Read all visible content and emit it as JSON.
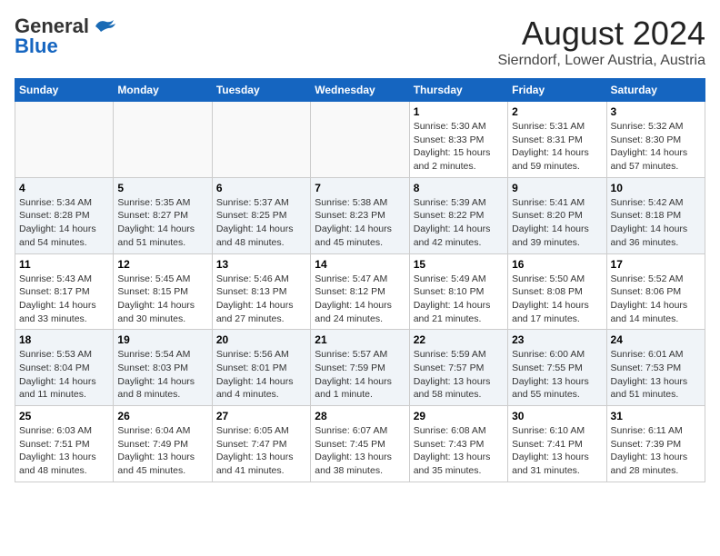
{
  "header": {
    "logo_general": "General",
    "logo_blue": "Blue",
    "month": "August 2024",
    "location": "Sierndorf, Lower Austria, Austria"
  },
  "weekdays": [
    "Sunday",
    "Monday",
    "Tuesday",
    "Wednesday",
    "Thursday",
    "Friday",
    "Saturday"
  ],
  "weeks": [
    [
      {
        "day": "",
        "info": ""
      },
      {
        "day": "",
        "info": ""
      },
      {
        "day": "",
        "info": ""
      },
      {
        "day": "",
        "info": ""
      },
      {
        "day": "1",
        "info": "Sunrise: 5:30 AM\nSunset: 8:33 PM\nDaylight: 15 hours\nand 2 minutes."
      },
      {
        "day": "2",
        "info": "Sunrise: 5:31 AM\nSunset: 8:31 PM\nDaylight: 14 hours\nand 59 minutes."
      },
      {
        "day": "3",
        "info": "Sunrise: 5:32 AM\nSunset: 8:30 PM\nDaylight: 14 hours\nand 57 minutes."
      }
    ],
    [
      {
        "day": "4",
        "info": "Sunrise: 5:34 AM\nSunset: 8:28 PM\nDaylight: 14 hours\nand 54 minutes."
      },
      {
        "day": "5",
        "info": "Sunrise: 5:35 AM\nSunset: 8:27 PM\nDaylight: 14 hours\nand 51 minutes."
      },
      {
        "day": "6",
        "info": "Sunrise: 5:37 AM\nSunset: 8:25 PM\nDaylight: 14 hours\nand 48 minutes."
      },
      {
        "day": "7",
        "info": "Sunrise: 5:38 AM\nSunset: 8:23 PM\nDaylight: 14 hours\nand 45 minutes."
      },
      {
        "day": "8",
        "info": "Sunrise: 5:39 AM\nSunset: 8:22 PM\nDaylight: 14 hours\nand 42 minutes."
      },
      {
        "day": "9",
        "info": "Sunrise: 5:41 AM\nSunset: 8:20 PM\nDaylight: 14 hours\nand 39 minutes."
      },
      {
        "day": "10",
        "info": "Sunrise: 5:42 AM\nSunset: 8:18 PM\nDaylight: 14 hours\nand 36 minutes."
      }
    ],
    [
      {
        "day": "11",
        "info": "Sunrise: 5:43 AM\nSunset: 8:17 PM\nDaylight: 14 hours\nand 33 minutes."
      },
      {
        "day": "12",
        "info": "Sunrise: 5:45 AM\nSunset: 8:15 PM\nDaylight: 14 hours\nand 30 minutes."
      },
      {
        "day": "13",
        "info": "Sunrise: 5:46 AM\nSunset: 8:13 PM\nDaylight: 14 hours\nand 27 minutes."
      },
      {
        "day": "14",
        "info": "Sunrise: 5:47 AM\nSunset: 8:12 PM\nDaylight: 14 hours\nand 24 minutes."
      },
      {
        "day": "15",
        "info": "Sunrise: 5:49 AM\nSunset: 8:10 PM\nDaylight: 14 hours\nand 21 minutes."
      },
      {
        "day": "16",
        "info": "Sunrise: 5:50 AM\nSunset: 8:08 PM\nDaylight: 14 hours\nand 17 minutes."
      },
      {
        "day": "17",
        "info": "Sunrise: 5:52 AM\nSunset: 8:06 PM\nDaylight: 14 hours\nand 14 minutes."
      }
    ],
    [
      {
        "day": "18",
        "info": "Sunrise: 5:53 AM\nSunset: 8:04 PM\nDaylight: 14 hours\nand 11 minutes."
      },
      {
        "day": "19",
        "info": "Sunrise: 5:54 AM\nSunset: 8:03 PM\nDaylight: 14 hours\nand 8 minutes."
      },
      {
        "day": "20",
        "info": "Sunrise: 5:56 AM\nSunset: 8:01 PM\nDaylight: 14 hours\nand 4 minutes."
      },
      {
        "day": "21",
        "info": "Sunrise: 5:57 AM\nSunset: 7:59 PM\nDaylight: 14 hours\nand 1 minute."
      },
      {
        "day": "22",
        "info": "Sunrise: 5:59 AM\nSunset: 7:57 PM\nDaylight: 13 hours\nand 58 minutes."
      },
      {
        "day": "23",
        "info": "Sunrise: 6:00 AM\nSunset: 7:55 PM\nDaylight: 13 hours\nand 55 minutes."
      },
      {
        "day": "24",
        "info": "Sunrise: 6:01 AM\nSunset: 7:53 PM\nDaylight: 13 hours\nand 51 minutes."
      }
    ],
    [
      {
        "day": "25",
        "info": "Sunrise: 6:03 AM\nSunset: 7:51 PM\nDaylight: 13 hours\nand 48 minutes."
      },
      {
        "day": "26",
        "info": "Sunrise: 6:04 AM\nSunset: 7:49 PM\nDaylight: 13 hours\nand 45 minutes."
      },
      {
        "day": "27",
        "info": "Sunrise: 6:05 AM\nSunset: 7:47 PM\nDaylight: 13 hours\nand 41 minutes."
      },
      {
        "day": "28",
        "info": "Sunrise: 6:07 AM\nSunset: 7:45 PM\nDaylight: 13 hours\nand 38 minutes."
      },
      {
        "day": "29",
        "info": "Sunrise: 6:08 AM\nSunset: 7:43 PM\nDaylight: 13 hours\nand 35 minutes."
      },
      {
        "day": "30",
        "info": "Sunrise: 6:10 AM\nSunset: 7:41 PM\nDaylight: 13 hours\nand 31 minutes."
      },
      {
        "day": "31",
        "info": "Sunrise: 6:11 AM\nSunset: 7:39 PM\nDaylight: 13 hours\nand 28 minutes."
      }
    ]
  ]
}
